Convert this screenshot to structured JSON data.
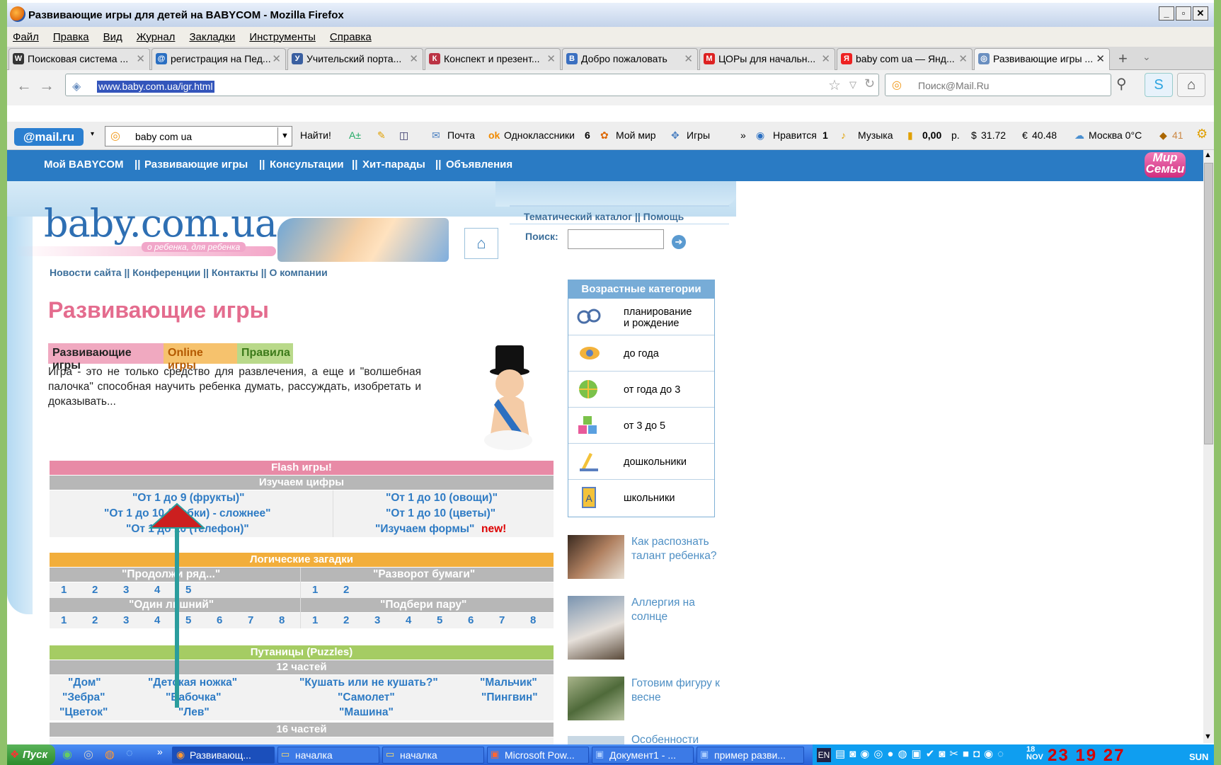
{
  "window": {
    "title": "Развивающие игры для детей на BABYCOM - Mozilla Firefox"
  },
  "menu": [
    "Файл",
    "Правка",
    "Вид",
    "Журнал",
    "Закладки",
    "Инструменты",
    "Справка"
  ],
  "tabs": [
    {
      "label": "Поисковая система ...",
      "icon": "W"
    },
    {
      "label": "регистрация на Пед...",
      "icon": "@"
    },
    {
      "label": "Учительский порта...",
      "icon": "У"
    },
    {
      "label": "Конспект и презент...",
      "icon": "К"
    },
    {
      "label": "Добро пожаловать",
      "icon": "B"
    },
    {
      "label": "ЦОРы для начальн...",
      "icon": "M"
    },
    {
      "label": "baby com ua — Янд...",
      "icon": "Я"
    },
    {
      "label": "Развивающие игры ...",
      "icon": "◎"
    }
  ],
  "nav": {
    "url": "www.baby.com.ua/igr.html",
    "search_placeholder": "Поиск@Mail.Ru"
  },
  "mailbar": {
    "logo": "@mail.ru",
    "query": "baby com ua",
    "find": "Найти!",
    "items": [
      "Почта",
      "Одноклассники",
      "6",
      "Мой мир",
      "Игры",
      "»",
      "Нравится",
      "1",
      "Музыка",
      "0,00",
      "р.",
      "$",
      "31.72",
      "€",
      "40.48",
      "Москва 0°C",
      "41"
    ]
  },
  "site": {
    "nav": [
      "Мой BABYCOM",
      "||",
      "Развивающие игры",
      "||",
      "Консультации",
      "||",
      "Хит-парады",
      "||",
      "Объявления"
    ],
    "mir_logo": "Мир Семьи",
    "logo": "baby.com.ua",
    "logo_sub": "о ребенка, для ребенка",
    "top_links": "Тематический каталог  ||  Помощь",
    "search_label": "Поиск:",
    "sub_links": "Новости сайта  ||  Конференции  ||  Контакты  ||  О компании",
    "title": "Развивающие игры",
    "page_tabs": [
      "Развивающие игры",
      "Online игры",
      "Правила"
    ],
    "intro": "Игра - это не только средство для развлечения, а еще и \"волшебная палочка\" способная научить ребенка думать, рассуждать, изобретать и доказывать..."
  },
  "games": {
    "flash": "Flash игры!",
    "digits": "Изучаем цифры",
    "digits_rows": [
      [
        "\"От 1 до 9 (фрукты)\"",
        "\"От 1 до 10 (овощи)\""
      ],
      [
        "\"От 1 до 10 (рыбки) - сложнее\"",
        "\"От 1 до 10 (цветы)\""
      ],
      [
        "\"От 1 до 10 (телефон)\"",
        "\"Изучаем формы\""
      ]
    ],
    "new_label": "new!",
    "logic": "Логические загадки",
    "logic_head1": [
      "\"Продолжи ряд...\"",
      "\"Разворот бумаги\""
    ],
    "logic_row1_left": [
      "1",
      "2",
      "3",
      "4",
      "5"
    ],
    "logic_row1_right": [
      "1",
      "2"
    ],
    "logic_head2": [
      "\"Один лишний\"",
      "\"Подбери пару\""
    ],
    "logic_row2": [
      "1",
      "2",
      "3",
      "4",
      "5",
      "6",
      "7",
      "8"
    ],
    "puzzles": "Путаницы (Puzzles)",
    "twelve": "12 частей",
    "puzzle_rows": [
      [
        "\"Дом\"",
        "\"Детская ножка\"",
        "\"Кушать или не кушать?\"",
        "\"Мальчик\""
      ],
      [
        "\"Зебра\"",
        "\"Бабочка\"",
        "\"Самолет\"",
        "\"Пингвин\""
      ],
      [
        "\"Цветок\"",
        "\"Лев\"",
        "\"Машина\"",
        ""
      ]
    ],
    "sixteen": "16 частей"
  },
  "age": {
    "head": "Возрастные категории",
    "items": [
      "планирование\nи рождение",
      "до года",
      "от года до 3",
      "от 3 до 5",
      "дошкольники",
      "школьники"
    ]
  },
  "articles": [
    "Как распознать талант ребенка?",
    "Аллергия на солнце",
    "Готовим фигуру к весне",
    "Особенности"
  ],
  "taskbar": {
    "start": "Пуск",
    "items": [
      "Развивающ...",
      "началка",
      "началка",
      "Microsoft Pow...",
      "Документ1 - ...",
      "пример разви..."
    ],
    "lang": "EN",
    "date_day": "18",
    "date_month": "NOV",
    "clock": "23  19  27",
    "weekday": "SUN"
  },
  "colors": {
    "site_nav": "#2a7bc4",
    "pink": "#e46c8e",
    "flash_band": "#e88aa6",
    "logic_band": "#f2ae3b",
    "puzzle_band": "#a5cc63",
    "arrow": "#2a9d9d",
    "arrow_head": "#cc1f1f"
  }
}
